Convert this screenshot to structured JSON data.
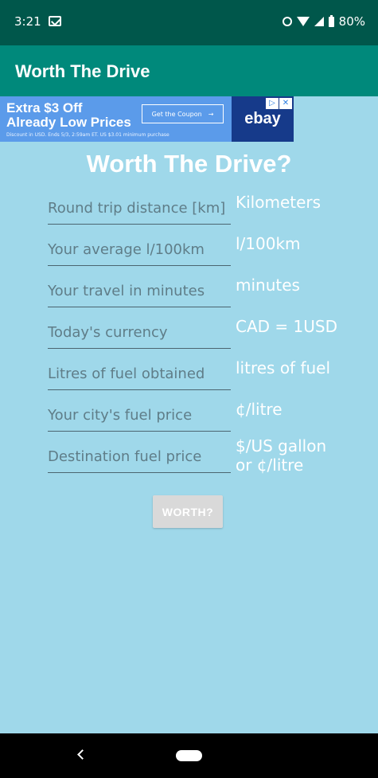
{
  "status_bar": {
    "time": "3:21",
    "battery": "80%",
    "icons": [
      "gmail-icon",
      "alarm-icon",
      "wifi-icon",
      "signal-icon",
      "battery-icon"
    ]
  },
  "app_bar": {
    "title": "Worth The Drive"
  },
  "ad": {
    "headline_line1": "Extra $3 Off",
    "headline_line2": "Already Low Prices",
    "fine_print": "Discount in USD. Ends 5/3, 2:59am ET. US $3.01 minimum purchase",
    "cta": "Get the Coupon",
    "cta_arrow": "→",
    "brand": "ebay",
    "choices_icon": "▷",
    "close_icon": "✕"
  },
  "main": {
    "title": "Worth The Drive?",
    "fields": [
      {
        "placeholder": "Round trip distance [km]",
        "unit": "Kilometers"
      },
      {
        "placeholder": "Your average l/100km",
        "unit": "l/100km"
      },
      {
        "placeholder": "Your travel in minutes",
        "unit": "minutes"
      },
      {
        "placeholder": "Today's currency",
        "unit": "CAD = 1USD"
      },
      {
        "placeholder": "Litres of fuel obtained",
        "unit": "litres of fuel"
      },
      {
        "placeholder": "Your city's fuel price",
        "unit": "¢/litre"
      },
      {
        "placeholder": "Destination fuel price",
        "unit_line1": "$/US gallon",
        "unit_line2": "or ¢/litre"
      }
    ],
    "button_label": "WORTH?"
  },
  "nav_bar": {
    "back_icon": "back-icon",
    "home_icon": "home-icon"
  },
  "colors": {
    "status_bar": "#00574b",
    "app_bar": "#00897b",
    "background": "#9fd8ea",
    "ad_background": "#5b9bea",
    "button": "#d9d9d9"
  }
}
